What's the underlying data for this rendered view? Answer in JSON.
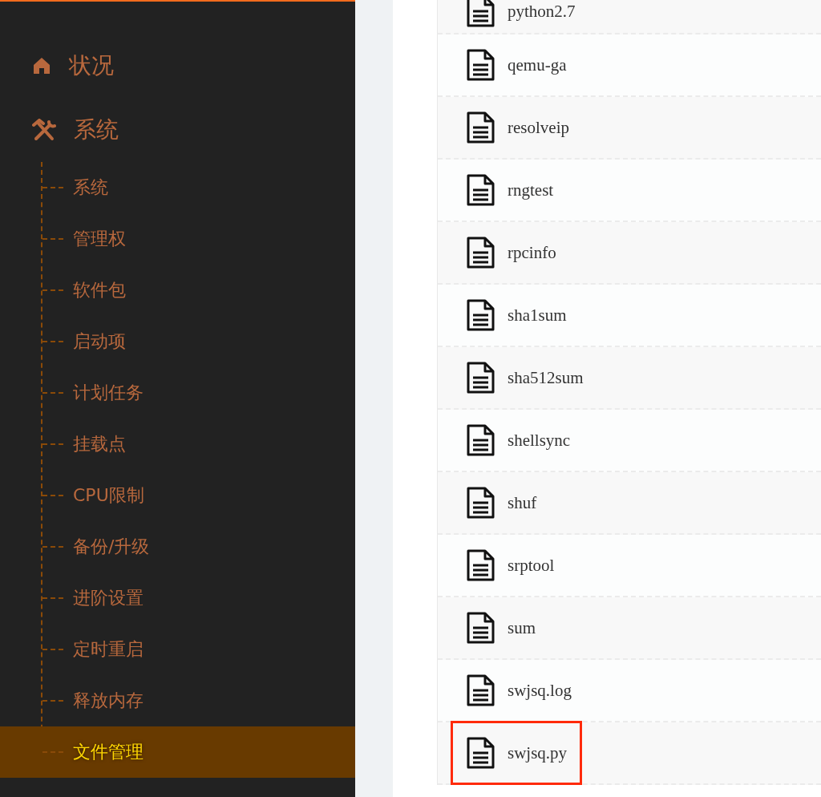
{
  "sidebar": {
    "items": [
      {
        "label": "状况"
      },
      {
        "label": "系统",
        "children": [
          {
            "label": "系统",
            "selected": false
          },
          {
            "label": "管理权",
            "selected": false
          },
          {
            "label": "软件包",
            "selected": false
          },
          {
            "label": "启动项",
            "selected": false
          },
          {
            "label": "计划任务",
            "selected": false
          },
          {
            "label": "挂载点",
            "selected": false
          },
          {
            "label": "CPU限制",
            "selected": false
          },
          {
            "label": "备份/升级",
            "selected": false
          },
          {
            "label": "进阶设置",
            "selected": false
          },
          {
            "label": "定时重启",
            "selected": false
          },
          {
            "label": "释放内存",
            "selected": false
          },
          {
            "label": "文件管理",
            "selected": true
          }
        ]
      }
    ]
  },
  "files": [
    {
      "name": "python2.7",
      "highlighted": false
    },
    {
      "name": "qemu-ga",
      "highlighted": false
    },
    {
      "name": "resolveip",
      "highlighted": false
    },
    {
      "name": "rngtest",
      "highlighted": false
    },
    {
      "name": "rpcinfo",
      "highlighted": false
    },
    {
      "name": "sha1sum",
      "highlighted": false
    },
    {
      "name": "sha512sum",
      "highlighted": false
    },
    {
      "name": "shellsync",
      "highlighted": false
    },
    {
      "name": "shuf",
      "highlighted": false
    },
    {
      "name": "srptool",
      "highlighted": false
    },
    {
      "name": "sum",
      "highlighted": false
    },
    {
      "name": "swjsq.log",
      "highlighted": false
    },
    {
      "name": "swjsq.py",
      "highlighted": true
    }
  ]
}
